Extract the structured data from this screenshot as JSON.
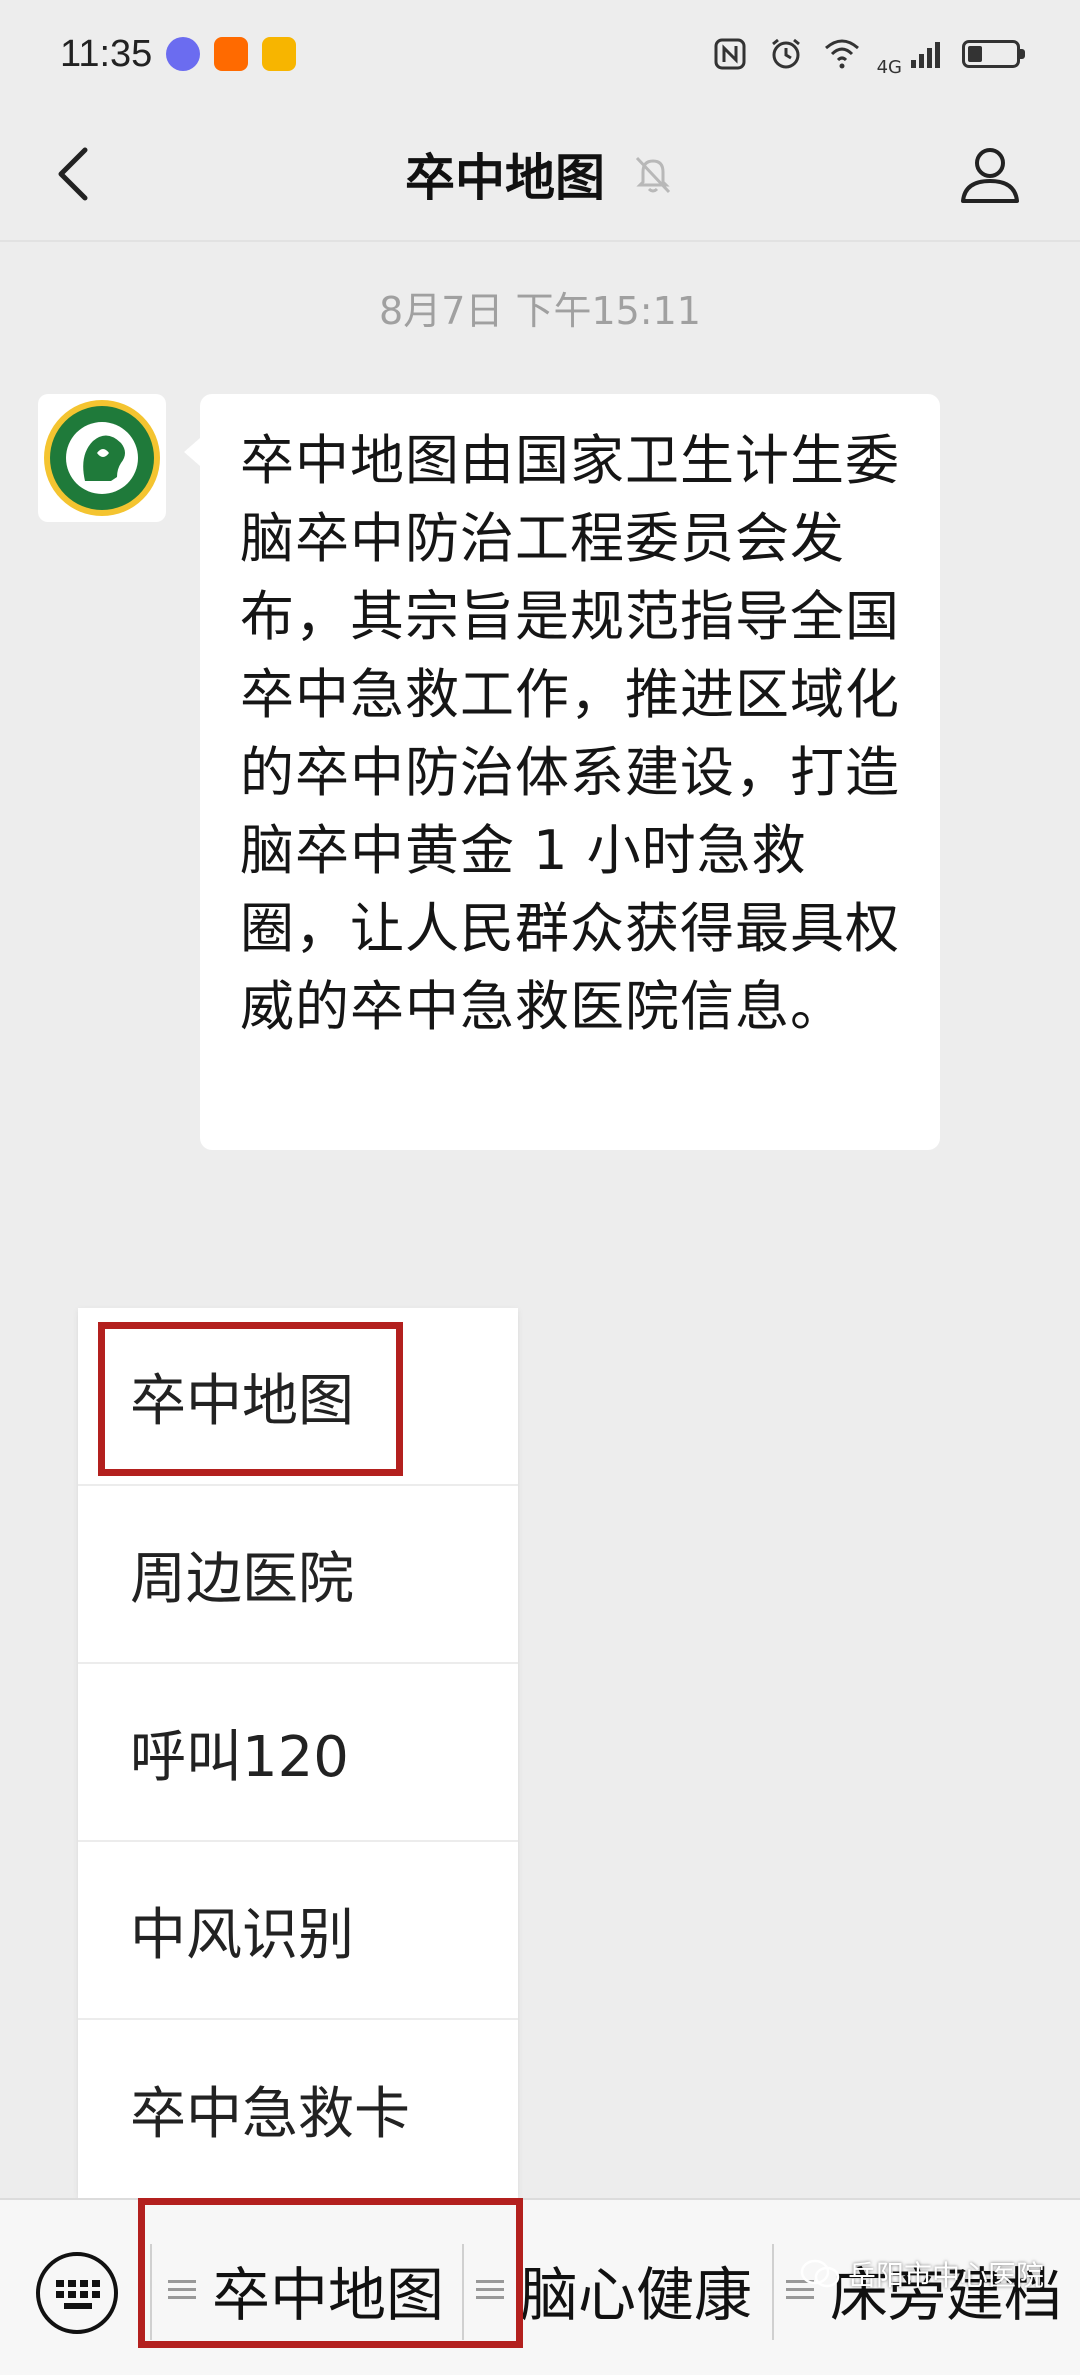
{
  "status_bar": {
    "time": "11:35",
    "network": "4G",
    "icons": [
      "qq-icon",
      "taobao-icon",
      "mail-icon",
      "nfc-icon",
      "alarm-icon",
      "wifi-icon",
      "signal-icon",
      "battery-icon"
    ]
  },
  "header": {
    "title": "卒中地图",
    "icons": {
      "back": "chevron-left-icon",
      "mute": "bell-muted-icon",
      "profile": "person-icon"
    }
  },
  "chat": {
    "timestamp": "8月7日 下午15:11",
    "message": "卒中地图由国家卫生计生委脑卒中防治工程委员会发布，其宗旨是规范指导全国卒中急救工作，推进区域化的卒中防治体系建设，打造脑卒中黄金 1 小时急救圈，让人民群众获得最具权威的卒中急救医院信息。"
  },
  "popup_menu": {
    "items": [
      {
        "label": "卒中地图"
      },
      {
        "label": "周边医院"
      },
      {
        "label": "呼叫120"
      },
      {
        "label": "中风识别"
      },
      {
        "label": "卒中急救卡"
      }
    ]
  },
  "bottom_bar": {
    "tabs": [
      {
        "label": "卒中地图"
      },
      {
        "label": "脑心健康"
      },
      {
        "label": "床旁建档"
      }
    ]
  },
  "watermark": {
    "text": "岳阳市中心医院"
  },
  "colors": {
    "background": "#ededed",
    "bubble": "#ffffff",
    "highlight": "#b3201e"
  }
}
